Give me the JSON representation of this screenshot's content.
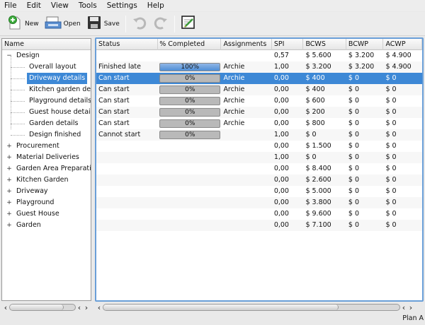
{
  "menu": [
    "File",
    "Edit",
    "View",
    "Tools",
    "Settings",
    "Help"
  ],
  "toolbar": {
    "new_label": "New",
    "open_label": "Open",
    "save_label": "Save"
  },
  "tree": {
    "header": "Name",
    "items": [
      {
        "label": "Design",
        "expander": "−",
        "level": 0
      },
      {
        "label": "Overall layout",
        "level": 1
      },
      {
        "label": "Driveway details",
        "level": 1,
        "selected": true
      },
      {
        "label": "Kitchen garden details",
        "level": 1
      },
      {
        "label": "Playground details",
        "level": 1
      },
      {
        "label": "Guest house details",
        "level": 1
      },
      {
        "label": "Garden details",
        "level": 1
      },
      {
        "label": "Design finished",
        "level": 1
      },
      {
        "label": "Procurement",
        "expander": "+",
        "level": 0
      },
      {
        "label": "Material Deliveries",
        "expander": "+",
        "level": 0
      },
      {
        "label": "Garden Area Preparation",
        "expander": "+",
        "level": 0
      },
      {
        "label": "Kitchen Garden",
        "expander": "+",
        "level": 0
      },
      {
        "label": "Driveway",
        "expander": "+",
        "level": 0
      },
      {
        "label": "Playground",
        "expander": "+",
        "level": 0
      },
      {
        "label": "Guest House",
        "expander": "+",
        "level": 0
      },
      {
        "label": "Garden",
        "expander": "+",
        "level": 0
      }
    ]
  },
  "table": {
    "columns": [
      "Status",
      "% Completed",
      "Assignments",
      "SPI",
      "BCWS",
      "BCWP",
      "ACWP"
    ],
    "rows": [
      {
        "status": "",
        "pct": null,
        "assign": "",
        "spi": "0,57",
        "bcws": "$ 5.600",
        "bcwp": "$ 3.200",
        "acwp": "$ 4.900"
      },
      {
        "status": "Finished late",
        "pct": 100,
        "pct_label": "100%",
        "assign": "Archie",
        "spi": "1,00",
        "bcws": "$ 3.200",
        "bcwp": "$ 3.200",
        "acwp": "$ 4.900"
      },
      {
        "status": "Can start",
        "pct": 0,
        "pct_label": "0%",
        "assign": "Archie",
        "spi": "0,00",
        "bcws": "$ 400",
        "bcwp": "$ 0",
        "acwp": "$ 0",
        "selected": true
      },
      {
        "status": "Can start",
        "pct": 0,
        "pct_label": "0%",
        "assign": "Archie",
        "spi": "0,00",
        "bcws": "$ 400",
        "bcwp": "$ 0",
        "acwp": "$ 0"
      },
      {
        "status": "Can start",
        "pct": 0,
        "pct_label": "0%",
        "assign": "Archie",
        "spi": "0,00",
        "bcws": "$ 600",
        "bcwp": "$ 0",
        "acwp": "$ 0"
      },
      {
        "status": "Can start",
        "pct": 0,
        "pct_label": "0%",
        "assign": "Archie",
        "spi": "0,00",
        "bcws": "$ 200",
        "bcwp": "$ 0",
        "acwp": "$ 0"
      },
      {
        "status": "Can start",
        "pct": 0,
        "pct_label": "0%",
        "assign": "Archie",
        "spi": "0,00",
        "bcws": "$ 800",
        "bcwp": "$ 0",
        "acwp": "$ 0"
      },
      {
        "status": "Cannot start",
        "pct": 0,
        "pct_label": "0%",
        "assign": "",
        "spi": "1,00",
        "bcws": "$ 0",
        "bcwp": "$ 0",
        "acwp": "$ 0"
      },
      {
        "status": "",
        "pct": null,
        "assign": "",
        "spi": "0,00",
        "bcws": "$ 1.500",
        "bcwp": "$ 0",
        "acwp": "$ 0"
      },
      {
        "status": "",
        "pct": null,
        "assign": "",
        "spi": "1,00",
        "bcws": "$ 0",
        "bcwp": "$ 0",
        "acwp": "$ 0"
      },
      {
        "status": "",
        "pct": null,
        "assign": "",
        "spi": "0,00",
        "bcws": "$ 8.400",
        "bcwp": "$ 0",
        "acwp": "$ 0"
      },
      {
        "status": "",
        "pct": null,
        "assign": "",
        "spi": "0,00",
        "bcws": "$ 2.600",
        "bcwp": "$ 0",
        "acwp": "$ 0"
      },
      {
        "status": "",
        "pct": null,
        "assign": "",
        "spi": "0,00",
        "bcws": "$ 5.000",
        "bcwp": "$ 0",
        "acwp": "$ 0"
      },
      {
        "status": "",
        "pct": null,
        "assign": "",
        "spi": "0,00",
        "bcws": "$ 3.800",
        "bcwp": "$ 0",
        "acwp": "$ 0"
      },
      {
        "status": "",
        "pct": null,
        "assign": "",
        "spi": "0,00",
        "bcws": "$ 9.600",
        "bcwp": "$ 0",
        "acwp": "$ 0"
      },
      {
        "status": "",
        "pct": null,
        "assign": "",
        "spi": "0,00",
        "bcws": "$ 7.100",
        "bcwp": "$ 0",
        "acwp": "$ 0"
      }
    ]
  },
  "status_bar": "Plan A",
  "colors": {
    "selection": "#3d88d6",
    "progress_fill": "#4f8ed6",
    "panel_border": "#6a9fd8"
  }
}
